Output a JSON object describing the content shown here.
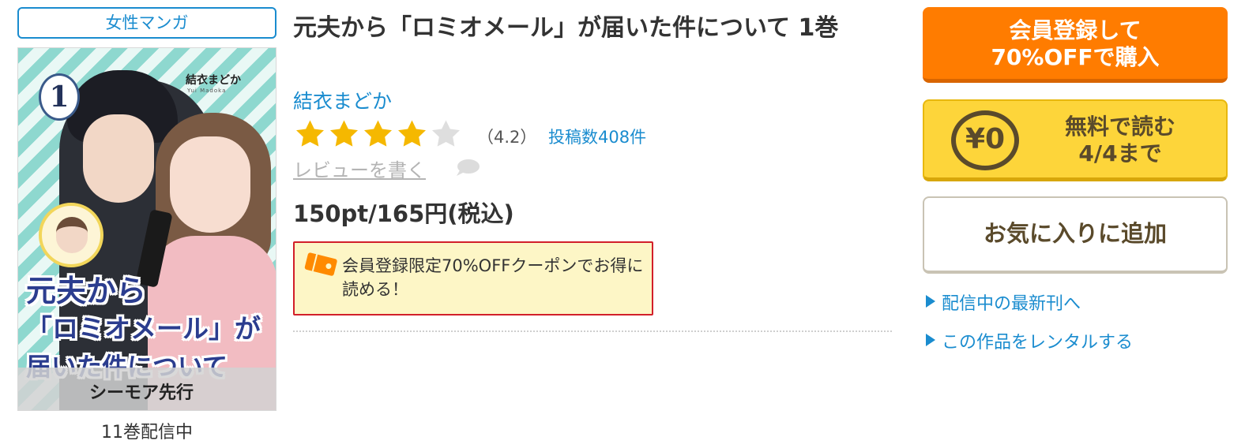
{
  "genre": "女性マンガ",
  "cover": {
    "volume": "1",
    "author": "結衣まどか",
    "author_en": "Yui Madoka",
    "title_lines": [
      "元夫から",
      "「ロミオメール」が",
      "届いた件について"
    ],
    "label": "シーモア先行"
  },
  "volumes_count": "11巻配信中",
  "title": "元夫から「ロミオメール」が届いた件について 1巻",
  "author": "結衣まどか",
  "rating": {
    "value": 4.2,
    "stars_filled": 4,
    "stars_total": 5,
    "label": "（4.2）"
  },
  "review_count": "投稿数408件",
  "write_review": "レビューを書く",
  "price": "150pt/165円(税込)",
  "coupon": {
    "text": "会員登録限定70%OFFクーポンでお得に読める！"
  },
  "buttons": {
    "buy_line1": "会員登録して",
    "buy_line2": "70%OFFで購入",
    "free_icon": "¥0",
    "free_line1": "無料で読む",
    "free_line2": "4/4まで",
    "favorite": "お気に入りに追加"
  },
  "links": {
    "latest": "配信中の最新刊へ",
    "rental": "この作品をレンタルする"
  },
  "colors": {
    "accent_blue": "#1a8ccf",
    "buy_orange": "#ff7c00",
    "free_yellow": "#fdd53a",
    "star_gold": "#f5b800",
    "coupon_red": "#d21f2a"
  }
}
